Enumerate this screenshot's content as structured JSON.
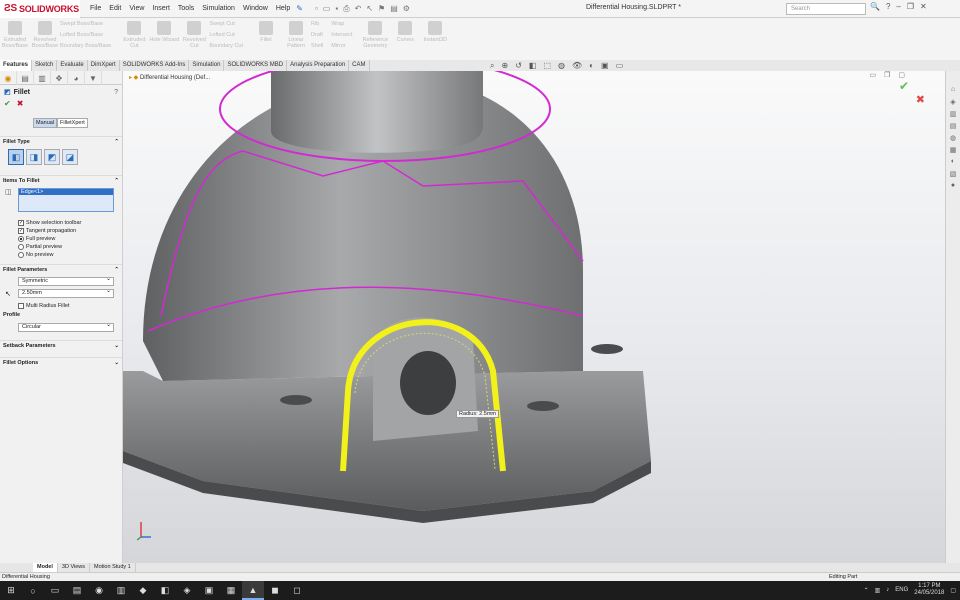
{
  "app": {
    "name": "SOLIDWORKS",
    "document_title": "Differential Housing.SLDPRT *"
  },
  "menu": [
    "File",
    "Edit",
    "View",
    "Insert",
    "Tools",
    "Simulation",
    "Window",
    "Help"
  ],
  "search": {
    "placeholder": "Search"
  },
  "command_manager": {
    "big": [
      "Extruded Boss/Base",
      "Revolved Boss/Base",
      "Extruded Cut",
      "Hole Wizard",
      "Revolved Cut",
      "Fillet",
      "Linear Pattern",
      "Reference Geometry",
      "Curves",
      "Instant3D"
    ],
    "small": [
      "Swept Boss/Base",
      "Lofted Boss/Base",
      "Boundary Boss/Base",
      "Swept Cut",
      "Lofted Cut",
      "Boundary Cut",
      "Rib",
      "Draft",
      "Shell",
      "Wrap",
      "Intersect",
      "Mirror"
    ]
  },
  "tabs": [
    "Features",
    "Sketch",
    "Evaluate",
    "DimXpert",
    "SOLIDWORKS Add-Ins",
    "Simulation",
    "SOLIDWORKS MBD",
    "Analysis Preparation",
    "CAM"
  ],
  "panel": {
    "title": "Fillet",
    "help": "?",
    "subtabs": [
      "Manual",
      "FilletXpert"
    ],
    "fillet_type_label": "Fillet Type",
    "items_label": "Items To Fillet",
    "selected_item": "Edge<1>",
    "options": {
      "show_toolbar": "Show selection toolbar",
      "tangent": "Tangent propagation",
      "full": "Full preview",
      "partial": "Partial preview",
      "none": "No preview"
    },
    "params_label": "Fillet Parameters",
    "symmetric": "Symmetric",
    "radius": "2.50mm",
    "multi_radius": "Multi Radius Fillet",
    "profile_label": "Profile",
    "profile": "Circular",
    "setback_label": "Setback Parameters",
    "fillet_options_label": "Fillet Options"
  },
  "viewport": {
    "tree_label": "Differential Housing  (Def...",
    "radius_tag": "Radius: 2.5mm"
  },
  "bottom_tabs": [
    "Model",
    "3D Views",
    "Motion Study 1"
  ],
  "status": {
    "left": "Differential Housing",
    "right": "Editing Part"
  },
  "taskbar": {
    "time": "1:17 PM",
    "date": "24/05/2018",
    "lang": "ENG"
  },
  "colors": {
    "accent": "#c8102e",
    "selection": "#2f6fc5",
    "highlight_edge": "#d22ad2",
    "preview": "#f2f21a",
    "model": "#8a8b8d"
  }
}
